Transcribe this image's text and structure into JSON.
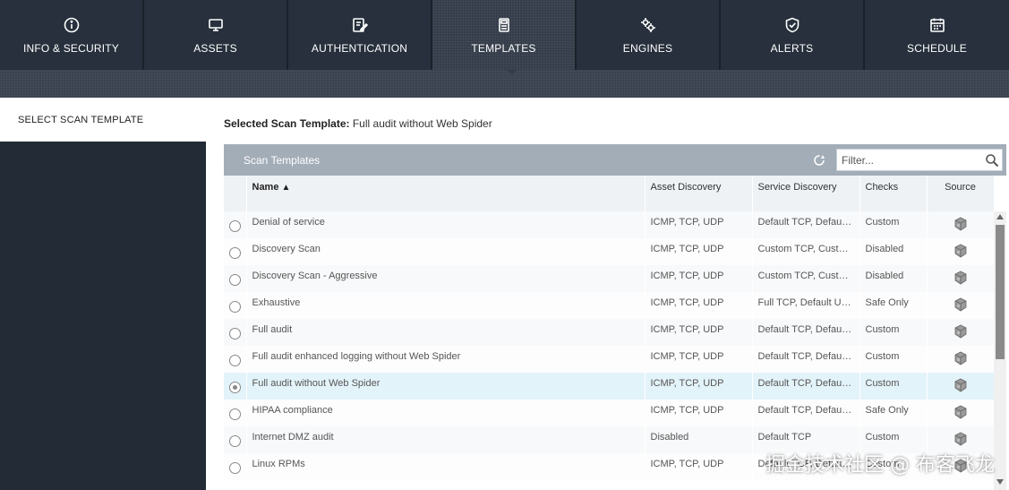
{
  "nav": {
    "tabs": [
      {
        "label": "INFO & SECURITY",
        "icon": "info-icon",
        "active": false
      },
      {
        "label": "ASSETS",
        "icon": "monitor-icon",
        "active": false
      },
      {
        "label": "AUTHENTICATION",
        "icon": "edit-icon",
        "active": false
      },
      {
        "label": "TEMPLATES",
        "icon": "template-icon",
        "active": true
      },
      {
        "label": "ENGINES",
        "icon": "gears-icon",
        "active": false
      },
      {
        "label": "ALERTS",
        "icon": "shield-icon",
        "active": false
      },
      {
        "label": "SCHEDULE",
        "icon": "calendar-icon",
        "active": false
      }
    ]
  },
  "sidebar": {
    "items": [
      {
        "label": "SELECT SCAN TEMPLATE",
        "active": true
      }
    ]
  },
  "main": {
    "selected_label": "Selected Scan Template:",
    "selected_value": "Full audit without Web Spider"
  },
  "panel": {
    "title": "Scan Templates",
    "filter_placeholder": "Filter...",
    "columns": [
      "Name",
      "Asset Discovery",
      "Service Discovery",
      "Checks",
      "Source"
    ],
    "sort_indicator": "^",
    "rows": [
      {
        "name": "Denial of service",
        "asset": "ICMP, TCP, UDP",
        "service": "Default TCP, Default UDP",
        "checks": "Custom",
        "selected": false
      },
      {
        "name": "Discovery Scan",
        "asset": "ICMP, TCP, UDP",
        "service": "Custom TCP, Custom UDP",
        "checks": "Disabled",
        "selected": false
      },
      {
        "name": "Discovery Scan - Aggressive",
        "asset": "ICMP, TCP, UDP",
        "service": "Custom TCP, Custom UDP",
        "checks": "Disabled",
        "selected": false
      },
      {
        "name": "Exhaustive",
        "asset": "ICMP, TCP, UDP",
        "service": "Full TCP, Default UDP",
        "checks": "Safe Only",
        "selected": false
      },
      {
        "name": "Full audit",
        "asset": "ICMP, TCP, UDP",
        "service": "Default TCP, Default UDP",
        "checks": "Custom",
        "selected": false
      },
      {
        "name": "Full audit enhanced logging without Web Spider",
        "asset": "ICMP, TCP, UDP",
        "service": "Default TCP, Default UDP",
        "checks": "Custom",
        "selected": false
      },
      {
        "name": "Full audit without Web Spider",
        "asset": "ICMP, TCP, UDP",
        "service": "Default TCP, Default UDP",
        "checks": "Custom",
        "selected": true
      },
      {
        "name": "HIPAA compliance",
        "asset": "ICMP, TCP, UDP",
        "service": "Default TCP, Default UDP",
        "checks": "Safe Only",
        "selected": false
      },
      {
        "name": "Internet DMZ audit",
        "asset": "Disabled",
        "service": "Default TCP",
        "checks": "Custom",
        "selected": false
      },
      {
        "name": "Linux RPMs",
        "asset": "ICMP, TCP, UDP",
        "service": "Default TCP, Default UDP",
        "checks": "Custom",
        "selected": false
      }
    ]
  },
  "watermark": "掘金技术社区 @ 布客飞龙",
  "colors": {
    "nav_bg": "#27303c",
    "panel_head": "#a3adb8",
    "selected_row": "#e3f3fa"
  }
}
